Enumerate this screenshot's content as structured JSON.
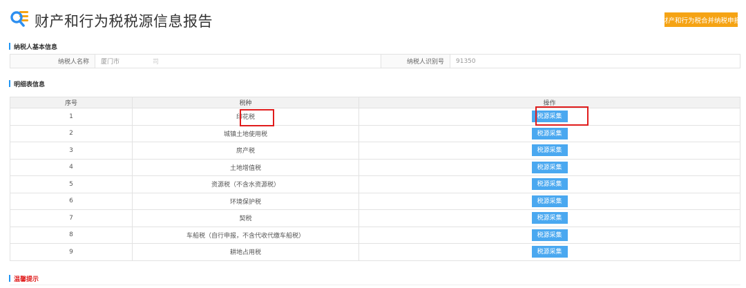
{
  "header": {
    "title": "财产和行为税税源信息报告",
    "merge_button": "财产和行为税合并纳税申报"
  },
  "taxpayer_section": {
    "title": "纳税人基本信息",
    "name_label": "纳税人名称",
    "name_value_prefix": "厦门市",
    "name_value_suffix": "司",
    "id_label": "纳税人识别号",
    "id_value": "91350"
  },
  "detail_section": {
    "title": "明细表信息",
    "columns": [
      "序号",
      "税种",
      "操作"
    ],
    "rows": [
      {
        "seq": "1",
        "tax": "印花税",
        "action": "税源采集"
      },
      {
        "seq": "2",
        "tax": "城镇土地使用税",
        "action": "税源采集"
      },
      {
        "seq": "3",
        "tax": "房产税",
        "action": "税源采集"
      },
      {
        "seq": "4",
        "tax": "土地增值税",
        "action": "税源采集"
      },
      {
        "seq": "5",
        "tax": "资源税（不含水资源税）",
        "action": "税源采集"
      },
      {
        "seq": "6",
        "tax": "环境保护税",
        "action": "税源采集"
      },
      {
        "seq": "7",
        "tax": "契税",
        "action": "税源采集"
      },
      {
        "seq": "8",
        "tax": "车船税（自行申报，不含代收代缴车船税）",
        "action": "税源采集"
      },
      {
        "seq": "9",
        "tax": "耕地占用税",
        "action": "税源采集"
      }
    ]
  },
  "notice_section": {
    "title": "温馨提示"
  },
  "colors": {
    "accent_orange": "#f5a314",
    "button_blue": "#4aa8f0",
    "section_bar": "#2196f3",
    "highlight_red": "#e01b1b",
    "notice_red": "#e02020"
  }
}
